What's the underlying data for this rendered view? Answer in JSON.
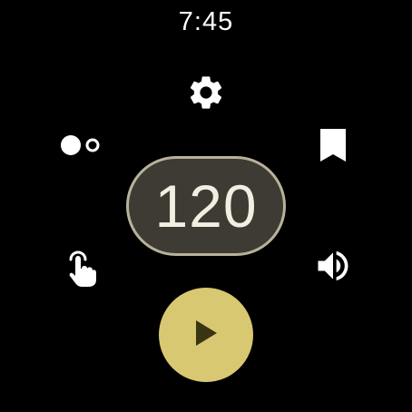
{
  "status_bar": {
    "time": "7:45"
  },
  "metronome": {
    "bpm": "120"
  },
  "icons": {
    "settings": "gear-icon",
    "theme": "toggle-dots-icon",
    "bookmark": "bookmark-icon",
    "touch": "touch-tap-icon",
    "volume": "volume-icon",
    "play": "play-icon"
  },
  "colors": {
    "background": "#000000",
    "pill_fill": "#3d3b33",
    "pill_border": "#b8b29a",
    "accent": "#d9c872",
    "play_glyph": "#3a3512"
  }
}
